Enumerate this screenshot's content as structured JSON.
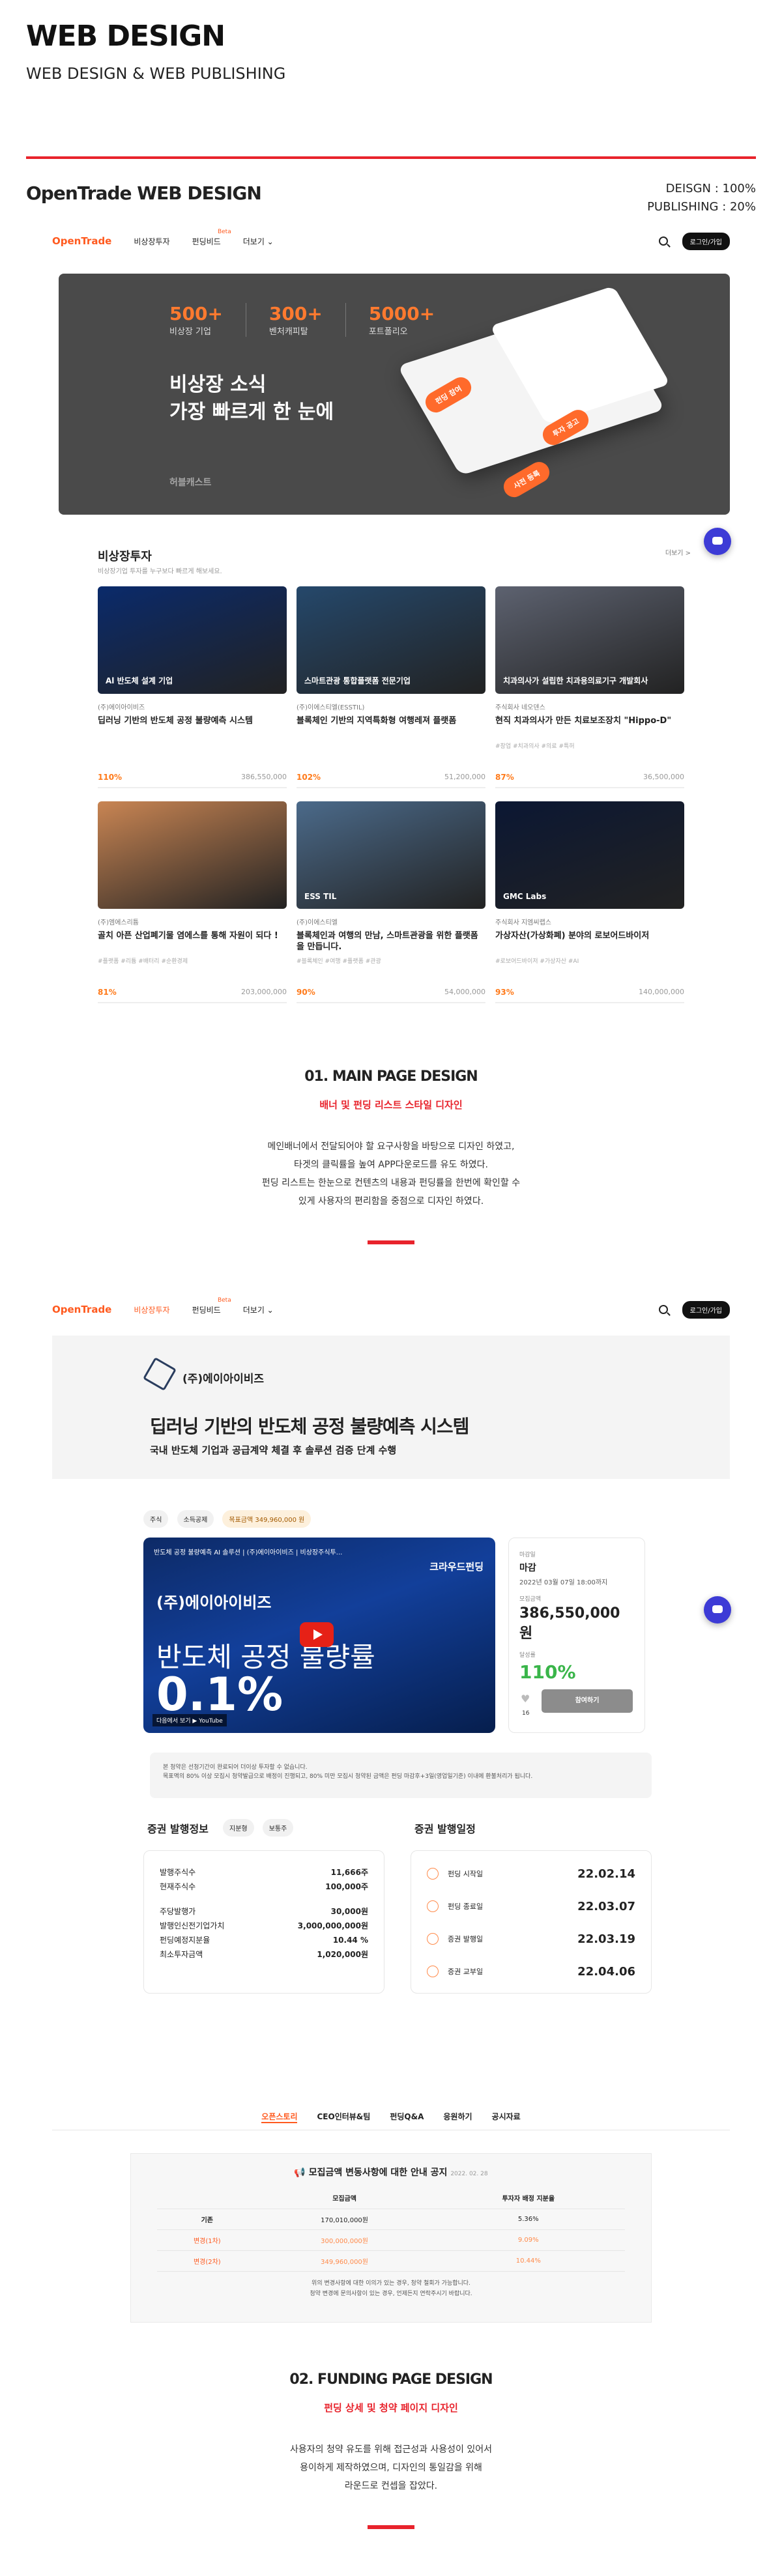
{
  "header": {
    "title": "WEB DESIGN",
    "subtitle": "WEB DESIGN & WEB PUBLISHING"
  },
  "project": {
    "title": "OpenTrade WEB DESIGN",
    "design": "DEISGN : 100%",
    "publishing": "PUBLISHING : 20%"
  },
  "nav": {
    "logo": "OpenTrade",
    "items": [
      "비상장투자",
      "펀딩비드",
      "더보기 ⌄"
    ],
    "beta": "Beta",
    "login": "로그인/가입"
  },
  "hero": {
    "stats": [
      {
        "num": "500+",
        "label": "비상장 기업"
      },
      {
        "num": "300+",
        "label": "벤처캐피탈"
      },
      {
        "num": "5000+",
        "label": "포트폴리오"
      }
    ],
    "title1": "비상장 소식",
    "title2": "가장 빠르게 한 눈에",
    "logo": "허블캐스트",
    "pill1": "펀딩 참여",
    "pill2": "투자 공고",
    "pill3": "사전 등록"
  },
  "invest": {
    "title": "비상장투자",
    "sub": "비상장기업 투자를 누구보다 빠르게 해보세요.",
    "more": "더보기 >"
  },
  "cards": [
    {
      "thumb": "Al 반도체 설계 기업",
      "company": "(주)에이아이비즈",
      "title": "딥러닝 기반의 반도체 공정 불량예측 시스템",
      "tags": "",
      "pct": "110%",
      "amt": "386,550,000",
      "color": "#0a2a6b"
    },
    {
      "thumb": "스마트관광 통합플랫폼 전문기업",
      "company": "(주)이에스티엘(ESSTIL)",
      "title": "블록체인 기반의 지역특화형 여행레져 플랫폼",
      "tags": "",
      "pct": "102%",
      "amt": "51,200,000",
      "color": "#25486b"
    },
    {
      "thumb": "치과의사가 설립한 치과용의료기구 개발회사",
      "company": "주식회사 네오덴스",
      "title": "현직 치과의사가 만든 치료보조장치 \"Hippo-D\"",
      "tags": "#창업 #치과의사 #의료 #특허",
      "pct": "87%",
      "amt": "36,500,000",
      "color": "#5d6270"
    },
    {
      "thumb": "",
      "company": "(주)엠에스리튬",
      "title": "골치 아픈 산업폐기물 염에스를 통해 자원이 되다 !",
      "tags": "#플랫폼 #리튬 #배터리 #순환경제",
      "pct": "81%",
      "amt": "203,000,000",
      "color": "#c98553"
    },
    {
      "thumb": "ESS TIL",
      "company": "(주)이에스티엘",
      "title": "블록체인과 여행의 만남, 스마트관광을 위한 플랫폼을 만듭니다.",
      "tags": "#블록체인 #여행 #플랫폼 #관광",
      "pct": "90%",
      "amt": "54,000,000",
      "color": "#4b6a8a"
    },
    {
      "thumb": "GMC Labs",
      "company": "주식회사 지엠씨랩스",
      "title": "가상자산(가상화폐) 분야의 로보어드바이저",
      "tags": "#로보어드바이저 #가상자산 #AI",
      "pct": "93%",
      "amt": "140,000,000",
      "color": "#0b1733"
    }
  ],
  "desc1": {
    "title": "01. MAIN PAGE DESIGN",
    "red": "배너 및 펀딩 리스트 스타일 디자인",
    "p1": "메인배너에서 전달되어야 할 요구사항을 바탕으로 디자인 하였고,",
    "p2": "타겟의 클릭률을 높여 APP다운로드를 유도 하였다.",
    "p3": "펀딩 리스트는 한눈으로 컨텐츠의 내용과 펀딩률을 한번에 확인할 수",
    "p4": "있게 사용자의 편리함을 중점으로 디자인 하였다."
  },
  "detail": {
    "company": "(주)에이아이비즈",
    "title": "딥러닝 기반의 반도체 공정 불량예측 시스템",
    "sub": "국내 반도체 기업과 공급계약 체결 후 솔루션 검증 단계 수행",
    "chips": [
      "주식",
      "소득공제",
      "목표금액 349,960,000 원"
    ],
    "video": {
      "top": "반도체 공정 불량예측 AI 솔루션 | (주)에이아이비즈 | 비상장주식투...",
      "corner": "크라우드펀딩",
      "brand": "(주)에이아이비즈",
      "big1": "반도체 공정 불량률",
      "big2": "0.1%",
      "yt": "다음에서 보기 ▶ YouTube"
    },
    "side": {
      "l1": "마감일",
      "v1": "마감",
      "d1": "2022년 03월 07일 18:00까지",
      "l2": "모집금액",
      "v2": "386,550,000 원",
      "l3": "달성률",
      "v3": "110%",
      "likes": "16",
      "btn": "참여하기"
    },
    "notice1": "본 청약은 선청기간이 완료되어 더이상 투자할 수 없습니다.",
    "notice2": "목표액의 80% 이상 모집시 청약발급으로 배정이 진행되고, 80% 미만 모집시 청약된 금액은 펀딩 마감후+3일(영업일기준) 이내에 환불처리가 됩니다."
  },
  "issue": {
    "title": "증권 발행정보",
    "chips": [
      "지분형",
      "보통주"
    ],
    "rows": [
      [
        "발행주식수",
        "11,666주"
      ],
      [
        "현재주식수",
        "100,000주"
      ],
      [
        "주당발행가",
        "30,000원"
      ],
      [
        "발행인신전기업가치",
        "3,000,000,000원"
      ],
      [
        "펀딩예정지분율",
        "10.44 %"
      ],
      [
        "최소투자금액",
        "1,020,000원"
      ]
    ]
  },
  "sched": {
    "title": "증권 발행일정",
    "rows": [
      [
        "펀딩 시작일",
        "22.02.14"
      ],
      [
        "펀딩 종료일",
        "22.03.07"
      ],
      [
        "증권 발행일",
        "22.03.19"
      ],
      [
        "증권 교부일",
        "22.04.06"
      ]
    ]
  },
  "tabs": [
    "오픈스토리",
    "CEO인터뷰&팀",
    "펀딩Q&A",
    "응원하기",
    "공시자료"
  ],
  "table": {
    "title": "모집금액 변동사항에 대한 안내 공지",
    "date": "2022. 02. 28",
    "head": [
      "",
      "모집금액",
      "투자자 배정 지분율"
    ],
    "rows": [
      [
        "기존",
        "170,010,000원",
        "5.36%"
      ],
      [
        "변경(1차)",
        "300,000,000원",
        "9.09%"
      ],
      [
        "변경(2차)",
        "349,960,000원",
        "10.44%"
      ]
    ],
    "n1": "위의 변경사항에 대한 이의가 있는 경우, 청약 철회가 가능합니다.",
    "n2": "청약 변경에 문의사항이 있는 경우, 언제든지 연락주시기 바랍니다."
  },
  "desc2": {
    "title": "02. FUNDING  PAGE DESIGN",
    "red": "펀딩 상세 및 청약 페이지 디자인",
    "p1": "사용자의 청약 유도를 위해 접근성과 사용성이 있어서",
    "p2": "용이하게 제작하였으며, 디자인의 통일감을 위해",
    "p3": "라운드로 컨셉을 잡았다."
  }
}
